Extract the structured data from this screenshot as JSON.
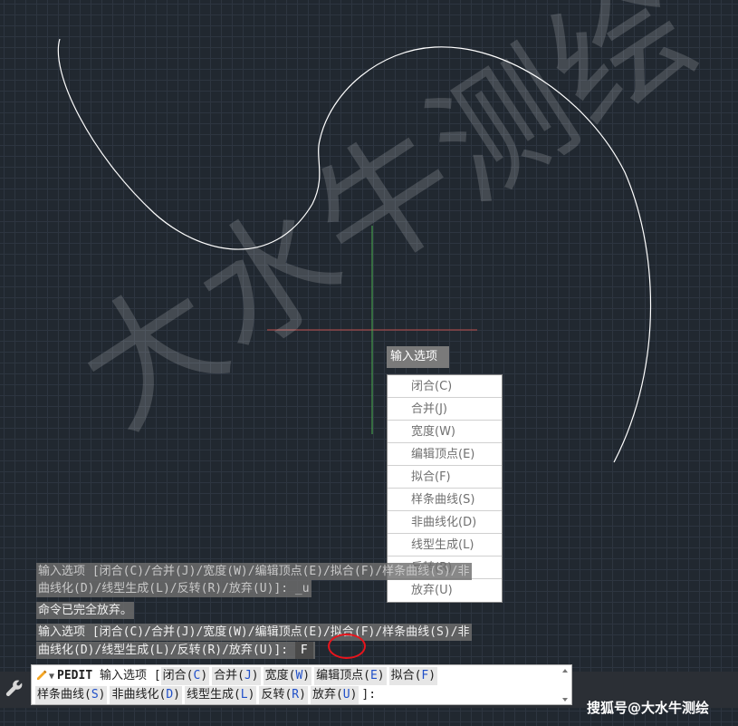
{
  "watermark": "大水牛测绘",
  "dynamic_input": {
    "label": "输入选项",
    "options": [
      "闭合(C)",
      "合并(J)",
      "宽度(W)",
      "编辑顶点(E)",
      "拟合(F)",
      "样条曲线(S)",
      "非曲线化(D)",
      "线型生成(L)",
      "反转(R)",
      "放弃(U)"
    ]
  },
  "history": {
    "line1": "输入选项 [闭合(C)/合并(J)/宽度(W)/编辑顶点(E)/拟合(F)/样条曲线(S)/非",
    "line2": "曲线化(D)/线型生成(L)/反转(R)/放弃(U)]: _u",
    "line3": "命令已完全放弃。",
    "line4": "输入选项 [闭合(C)/合并(J)/宽度(W)/编辑顶点(E)/拟合(F)/样条曲线(S)/非",
    "line5_prefix": "曲线化(D)/线型生成(L)/反转(R)/放弃(U)]:",
    "line5_input": "F"
  },
  "command_line": {
    "command": "PEDIT",
    "prompt": "输入选项 [",
    "options_row1": [
      {
        "text": "闭合(",
        "key": "C",
        "end": ")"
      },
      {
        "text": "合并(",
        "key": "J",
        "end": ")"
      },
      {
        "text": "宽度(",
        "key": "W",
        "end": ")"
      },
      {
        "text": "编辑顶点(",
        "key": "E",
        "end": ")"
      },
      {
        "text": "拟合(",
        "key": "F",
        "end": ")"
      }
    ],
    "options_row2": [
      {
        "text": "样条曲线(",
        "key": "S",
        "end": ")"
      },
      {
        "text": "非曲线化(",
        "key": "D",
        "end": ")"
      },
      {
        "text": "线型生成(",
        "key": "L",
        "end": ")"
      },
      {
        "text": "反转(",
        "key": "R",
        "end": ")"
      },
      {
        "text": "放弃(",
        "key": "U",
        "end": ")"
      }
    ],
    "suffix": "]:"
  },
  "footer_brand": "搜狐号@大水牛测绘",
  "colors": {
    "background": "#212830",
    "curve": "#ffffff",
    "crosshair_x": "#c0504d",
    "crosshair_y": "#4caf50",
    "option_key": "#1f4fc8",
    "highlight_circle": "#e8141c"
  },
  "icons": {
    "wrench": "wrench-icon",
    "command": "command-pen-icon",
    "dropdown": "chevron-down-icon"
  }
}
